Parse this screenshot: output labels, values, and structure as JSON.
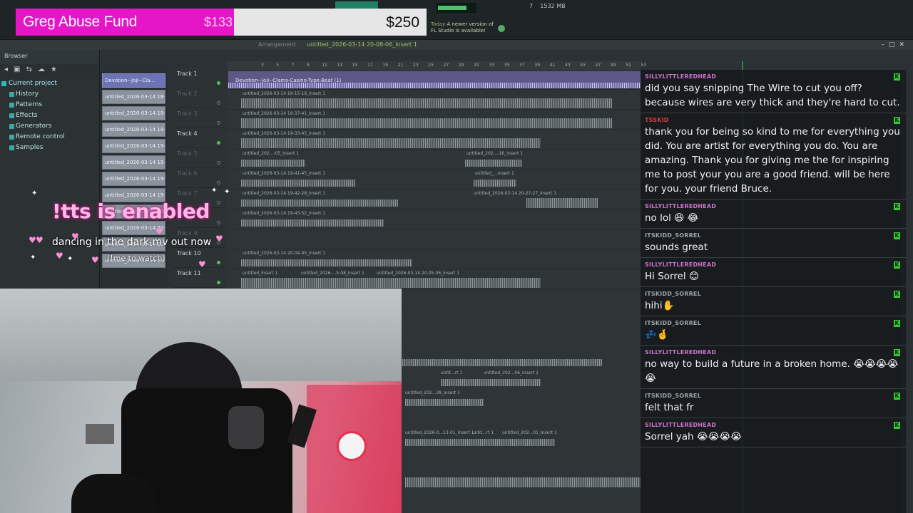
{
  "donation": {
    "title": "Greg Abuse Fund",
    "current": "$133",
    "goal": "$250",
    "progress": 0.532
  },
  "notification": {
    "today": "Today",
    "message": "A newer version of FL Studio is available!"
  },
  "system": {
    "memory": "1532 MB",
    "counter": "7"
  },
  "toolbar": {
    "view": "Arrangement",
    "project_title": "untitled_2026-03-14 20-08-06_Insert 1"
  },
  "browser": {
    "header": "Browser",
    "items": [
      {
        "label": "Current project"
      },
      {
        "label": "History"
      },
      {
        "label": "Patterns"
      },
      {
        "label": "Effects"
      },
      {
        "label": "Generators"
      },
      {
        "label": "Remote control"
      },
      {
        "label": "Samples"
      }
    ]
  },
  "pattern_list": [
    "Devotion--Joji--Cla...",
    "untitled_2026-03-14 18-",
    "untitled_2026-03-14 19-",
    "untitled_2026-03-14 19-",
    "untitled_2026-03-14 19-",
    "untitled_2026-03-14 19-",
    "untitled_2026-03-14 19-",
    "untitled_2026-03-14 19-",
    "untitled_2026-03-14 19-",
    "untitled_2026-03-14 20-",
    "untitled_2026-03-14 20-",
    "untitled_2026-03-14 20-"
  ],
  "tracks": [
    {
      "label": "Track 1",
      "active": true
    },
    {
      "label": "Track 2",
      "active": false
    },
    {
      "label": "Track 3",
      "active": false
    },
    {
      "label": "Track 4",
      "active": true
    },
    {
      "label": "Track 5",
      "active": false
    },
    {
      "label": "Track 6",
      "active": false
    },
    {
      "label": "Track 7",
      "active": false
    },
    {
      "label": "Track 8",
      "active": false
    },
    {
      "label": "Track 9",
      "active": false
    },
    {
      "label": "Track 10",
      "active": true
    },
    {
      "label": "Track 11",
      "active": true
    }
  ],
  "ruler": [
    "3",
    "5",
    "7",
    "9",
    "11",
    "13",
    "15",
    "17",
    "19",
    "21",
    "23",
    "25",
    "27",
    "29",
    "31",
    "33",
    "35",
    "37",
    "39",
    "41",
    "43",
    "45",
    "47",
    "49",
    "51",
    "53"
  ],
  "clips": {
    "main": "Devotion--Joji--Clams-Casino-Type-Beat (1)",
    "track2": "untitled_2026-03-14 19-15-16_Insert 1",
    "track3": "untitled_2026-03-14 19-37-41_Insert 1",
    "track4": "untitled_2026-03-14 19-33-45_Insert 1",
    "track5a": "untitled_202...-05_Insert 1",
    "track5b": "untitled_202...-16_Insert 1",
    "track6a": "untitled_2026-03-14 19-41-45_Insert 1",
    "track6b": "untitled_...Insert 1",
    "track7a": "untitled_2026-03-14 19-42-28_Insert 1",
    "track7b": "untitled_2026-03-14 20-27-27_Insert 1",
    "track8": "untitled_2026-03-14 19-43-52_Insert 1",
    "track10": "untitled_2026-03-14 20-04-05_Insert 1",
    "track11a": "untitled_Insert 1",
    "track11b": "untitled_2026-...5-08_Insert 1",
    "track11c": "untitled_2026-03-14 20-05-06_Insert 1",
    "low1": "untit...rt 1",
    "low2": "untitled_202...06_Insert 1",
    "low3": "untitled_202...28_Insert 1",
    "low4": "untitled_2026-0...13-01_Insert 1",
    "low5": "untit...rt 1",
    "low6": "untitled_202...01_Insert 1"
  },
  "overlay": {
    "tts": "!tts is enabled",
    "announcement": "dancing in the dark mv out now",
    "sub": "(!me to watch)"
  },
  "chat": [
    {
      "user": "SILLYLITTLEREDHEAD",
      "text": "did you say snipping The Wire to cut you off? because wires are very thick and they're hard to cut.",
      "style": "pink"
    },
    {
      "user": "TSSKID",
      "text": "thank you for being so kind to me for everything you did. You are artist for everything you do. You are amazing. Thank you for giving me the for inspiring me to post your you are a good friend. will be here for you. your friend Bruce.",
      "style": "red"
    },
    {
      "user": "SILLYLITTLEREDHEAD",
      "text": "no lol 😆 😂",
      "style": "pink"
    },
    {
      "user": "ITSKIDD_SORREL",
      "text": "sounds great",
      "style": "sor"
    },
    {
      "user": "SILLYLITTLEREDHEAD",
      "text": "Hi Sorrel 😊",
      "style": "pink"
    },
    {
      "user": "ITSKIDD_SORREL",
      "text": "hihi✋",
      "style": "sor"
    },
    {
      "user": "ITSKIDD_SORREL",
      "text": "💤🤞",
      "style": "sor"
    },
    {
      "user": "SILLYLITTLEREDHEAD",
      "text": "no way to build a future in a broken home. 😭😭😭😭😭",
      "style": "pink"
    },
    {
      "user": "ITSKIDD_SORREL",
      "text": "felt that fr",
      "style": "sor"
    },
    {
      "user": "SILLYLITTLEREDHEAD",
      "text": "Sorrel yah 😭😭😭😭",
      "style": "pink"
    }
  ],
  "colors": {
    "accent": "#e515c8",
    "chat_name": "#c873c9",
    "playhead": "#2fae5a",
    "pattern_active": "#6d74b5"
  }
}
